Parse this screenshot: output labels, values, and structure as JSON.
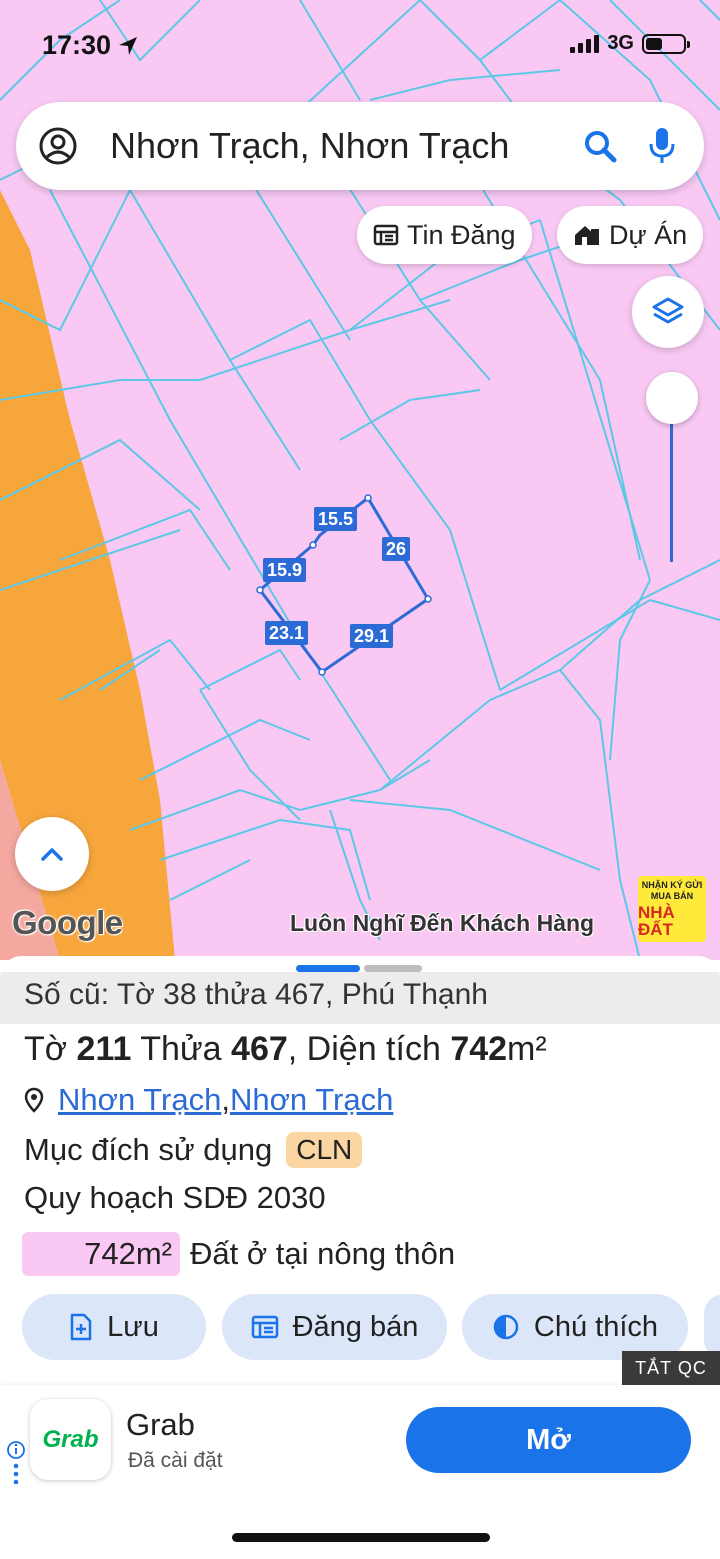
{
  "status_bar": {
    "time": "17:30",
    "network": "3G"
  },
  "search": {
    "text": "Nhơn Trạch, Nhơn Trạch"
  },
  "chips": {
    "listings": "Tin Đăng",
    "projects": "Dự Án"
  },
  "map": {
    "dimensions": [
      "15.5",
      "26",
      "15.9",
      "23.1",
      "29.1"
    ],
    "attribution": "Google",
    "watermark": {
      "text": "Luôn Nghĩ Đến Khách Hàng",
      "logo_line1": "NHẬN KÝ GỬI",
      "logo_line2": "MUA BÁN",
      "logo_line3": "NHÀ ĐẤT"
    },
    "colors": {
      "land": "#f9c9f4",
      "road": "#f7a63c",
      "boundary": "#2c6bd6",
      "lines": "#5cc8e6"
    }
  },
  "sheet": {
    "old_info": "Số cũ: Tờ 38 thửa 467, Phú Thạnh",
    "parcel": {
      "sheet_label": "Tờ",
      "sheet_no": "211",
      "plot_label": "Thửa",
      "plot_no": "467",
      "area_label": ", Diện tích",
      "area_value": "742",
      "area_unit": "m²"
    },
    "location": {
      "ward": "Nhơn Trạch",
      "separator": ", ",
      "district": "Nhơn Trạch"
    },
    "purpose": {
      "label": "Mục đích sử dụng",
      "code": "CLN"
    },
    "plan": {
      "label": "Quy hoạch SDĐ 2030"
    },
    "plan_area": {
      "value": "742m²",
      "desc": "Đất ở tại nông thôn"
    },
    "actions": {
      "save": "Lưu",
      "post": "Đăng bán",
      "note": "Chú thích"
    }
  },
  "ad": {
    "close_label": "TẮT QC",
    "app_name": "Grab",
    "app_logo": "Grab",
    "status": "Đã cài đặt",
    "cta": "Mở"
  }
}
